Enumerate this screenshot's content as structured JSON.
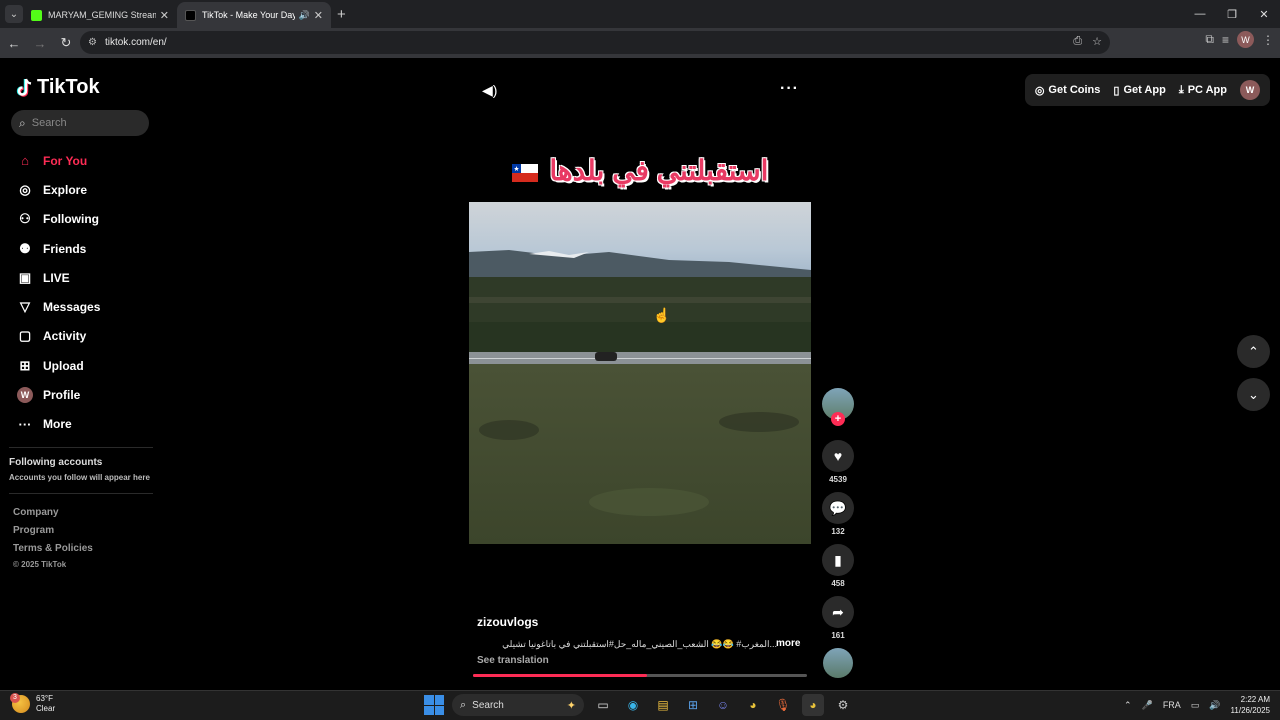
{
  "browser": {
    "tabs": [
      {
        "title": "MARYAM_GEMING Stream - Ki",
        "active": false
      },
      {
        "title": "TikTok - Make Your Day",
        "active": true
      }
    ],
    "url": "tiktok.com/en/",
    "profile_initial": "W"
  },
  "tiktok": {
    "logo": "TikTok",
    "search_placeholder": "Search",
    "nav": [
      {
        "label": "For You",
        "icon": "home-icon",
        "active": true
      },
      {
        "label": "Explore",
        "icon": "compass-icon"
      },
      {
        "label": "Following",
        "icon": "following-icon"
      },
      {
        "label": "Friends",
        "icon": "friends-icon"
      },
      {
        "label": "LIVE",
        "icon": "live-icon"
      },
      {
        "label": "Messages",
        "icon": "messages-icon"
      },
      {
        "label": "Activity",
        "icon": "activity-icon"
      },
      {
        "label": "Upload",
        "icon": "upload-icon"
      },
      {
        "label": "Profile",
        "icon": "profile-avatar"
      },
      {
        "label": "More",
        "icon": "more-icon"
      }
    ],
    "profile_initial": "W",
    "following_accounts_title": "Following accounts",
    "following_accounts_sub": "Accounts you follow will appear here",
    "footer_links": [
      "Company",
      "Program",
      "Terms & Policies"
    ],
    "copyright": "© 2025 TikTok",
    "top_buttons": {
      "coins": "Get Coins",
      "app": "Get App",
      "pc": "PC App",
      "avatar": "W"
    }
  },
  "video": {
    "overlay_caption": "استقبلتني في بلدها",
    "author": "zizouvlogs",
    "description": "...المغرب# 😂😂 الشعب_الصيني_ماله_حل#استقبلتني في باتاغونيا تشيلي",
    "more": "more",
    "see_translation": "See translation",
    "progress": 0.52,
    "likes": "4539",
    "comments": "132",
    "saves": "458",
    "shares": "161"
  },
  "taskbar": {
    "temp": "63°F",
    "weather": "Clear",
    "weather_badge": "3",
    "search": "Search",
    "lang": "FRA",
    "time": "2:22 AM",
    "date": "11/26/2025"
  }
}
